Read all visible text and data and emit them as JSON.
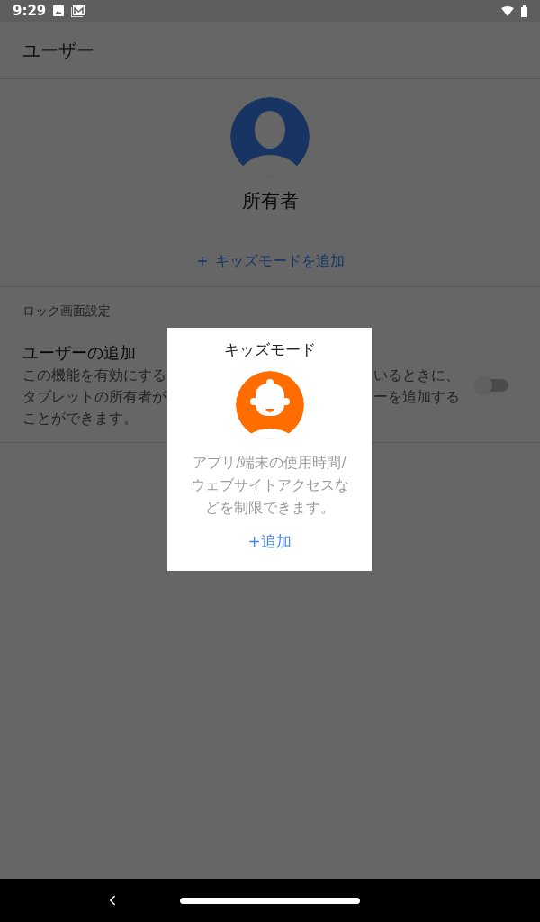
{
  "status_bar": {
    "time": "9:29"
  },
  "app_bar": {
    "title": "ユーザー"
  },
  "owner": {
    "name": "所有者"
  },
  "add_kids_mode": {
    "label": "キッズモードを追加"
  },
  "section": {
    "header": "ロック画面設定"
  },
  "setting": {
    "title": "ユーザーの追加",
    "toggle_on": false,
    "description_lines": [
      {
        "left": "この機能を有効にする",
        "right": "いるときに、"
      },
      {
        "left": "タブレットの所有者が",
        "right": "ーを追加する"
      },
      {
        "left": "ことができます。"
      }
    ]
  },
  "dialog": {
    "title": "キッズモード",
    "body": "アプリ/端末の使用時間/ウェブサイトアクセスなどを制限できます。",
    "action": "+追加"
  }
}
